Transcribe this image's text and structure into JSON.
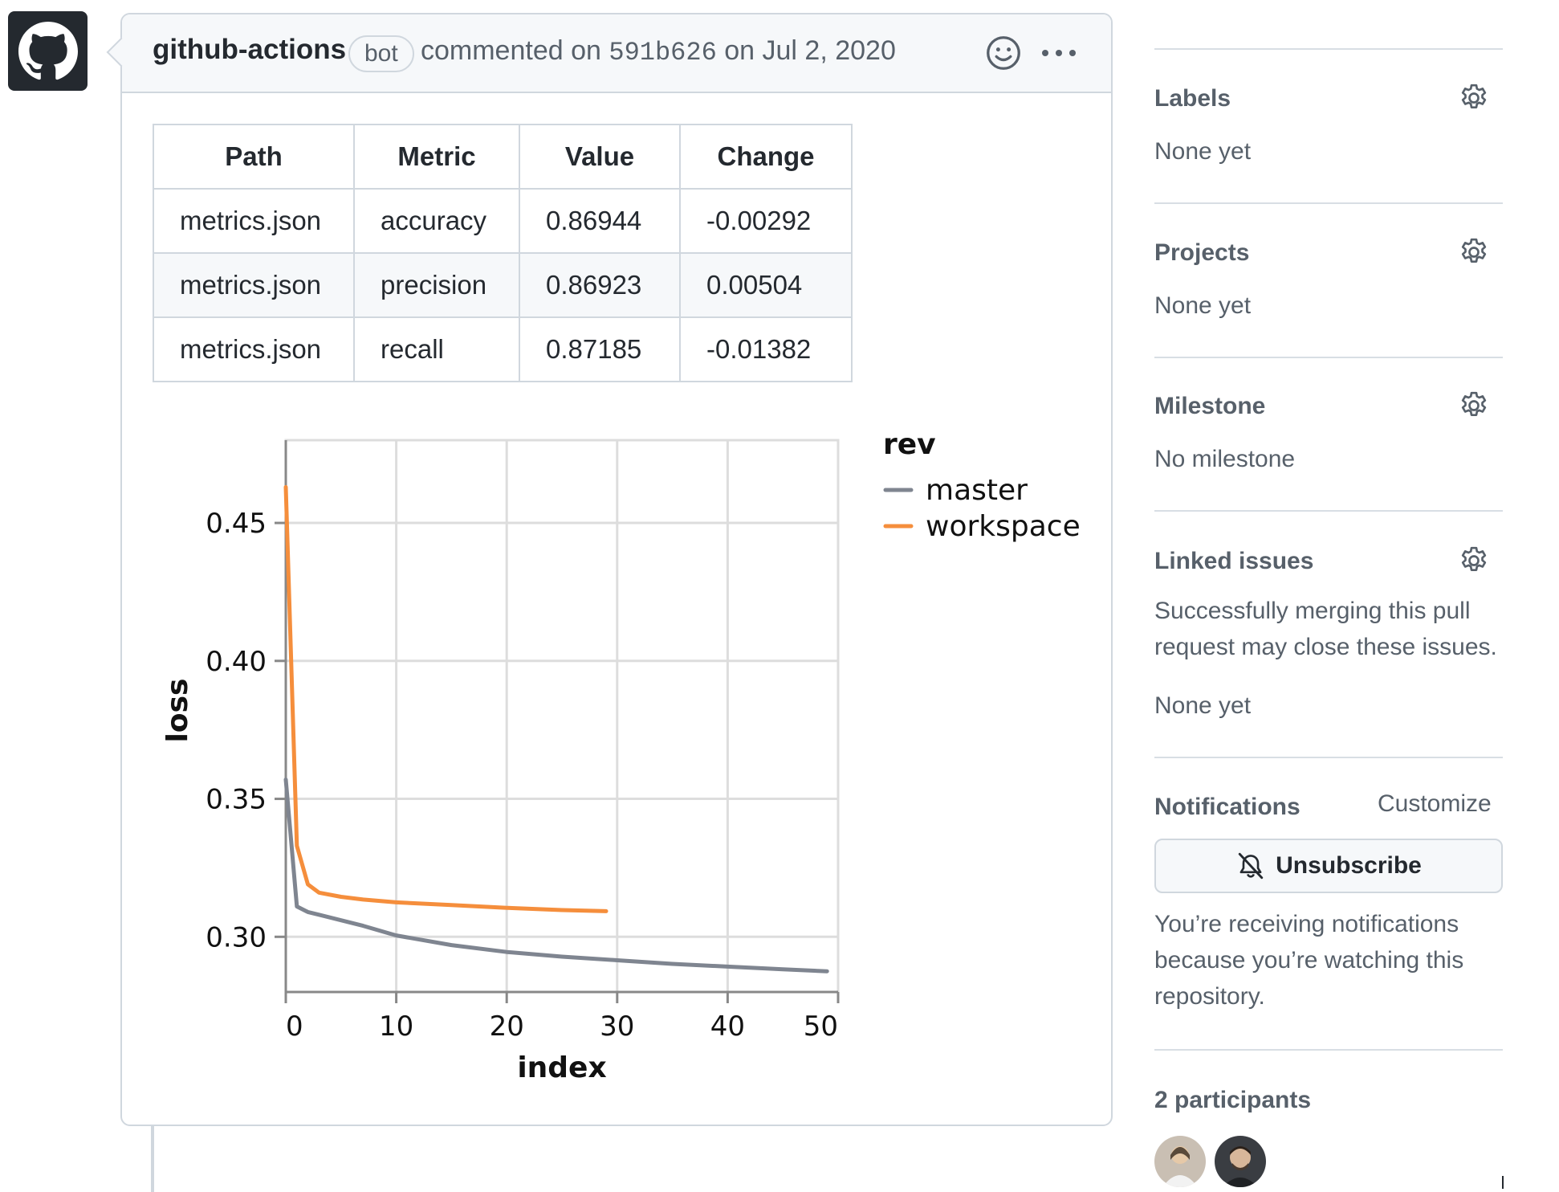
{
  "comment": {
    "author": "github-actions",
    "badge": "bot",
    "action_prefix": "commented on",
    "commit_sha": "591b626",
    "date_suffix": "on Jul 2, 2020",
    "table": {
      "headers": [
        "Path",
        "Metric",
        "Value",
        "Change"
      ],
      "rows": [
        [
          "metrics.json",
          "accuracy",
          "0.86944",
          "-0.00292"
        ],
        [
          "metrics.json",
          "precision",
          "0.86923",
          "0.00504"
        ],
        [
          "metrics.json",
          "recall",
          "0.87185",
          "-0.01382"
        ]
      ]
    }
  },
  "chart_data": {
    "type": "line",
    "xlabel": "index",
    "ylabel": "loss",
    "legend_title": "rev",
    "legend_position": "right",
    "grid": true,
    "xlim": [
      0,
      50
    ],
    "ylim": [
      0.28,
      0.48
    ],
    "xticks": [
      0,
      10,
      20,
      30,
      40,
      50
    ],
    "yticks": [
      0.3,
      0.35,
      0.4,
      0.45
    ],
    "series": [
      {
        "name": "master",
        "color": "#7f8590",
        "x": [
          0,
          1,
          2,
          3,
          5,
          7,
          10,
          15,
          20,
          25,
          30,
          35,
          40,
          45,
          49
        ],
        "y": [
          0.357,
          0.311,
          0.309,
          0.308,
          0.306,
          0.304,
          0.3005,
          0.297,
          0.2945,
          0.2928,
          0.2915,
          0.2902,
          0.2892,
          0.2882,
          0.2875
        ]
      },
      {
        "name": "workspace",
        "color": "#f58e3c",
        "x": [
          0,
          1,
          2,
          3,
          5,
          7,
          10,
          15,
          20,
          25,
          29
        ],
        "y": [
          0.463,
          0.333,
          0.319,
          0.316,
          0.3145,
          0.3135,
          0.3125,
          0.3115,
          0.3105,
          0.3097,
          0.3093
        ]
      }
    ]
  },
  "sidebar": {
    "labels": {
      "heading": "Labels",
      "value": "None yet"
    },
    "projects": {
      "heading": "Projects",
      "value": "None yet"
    },
    "milestone": {
      "heading": "Milestone",
      "value": "No milestone"
    },
    "linked_issues": {
      "heading": "Linked issues",
      "description": "Successfully merging this pull request may close these issues.",
      "value": "None yet"
    },
    "notifications": {
      "heading": "Notifications",
      "customize": "Customize",
      "unsubscribe": "Unsubscribe",
      "reason": "You’re receiving notifications because you’re watching this repository."
    },
    "participants": {
      "heading": "2 participants"
    }
  }
}
